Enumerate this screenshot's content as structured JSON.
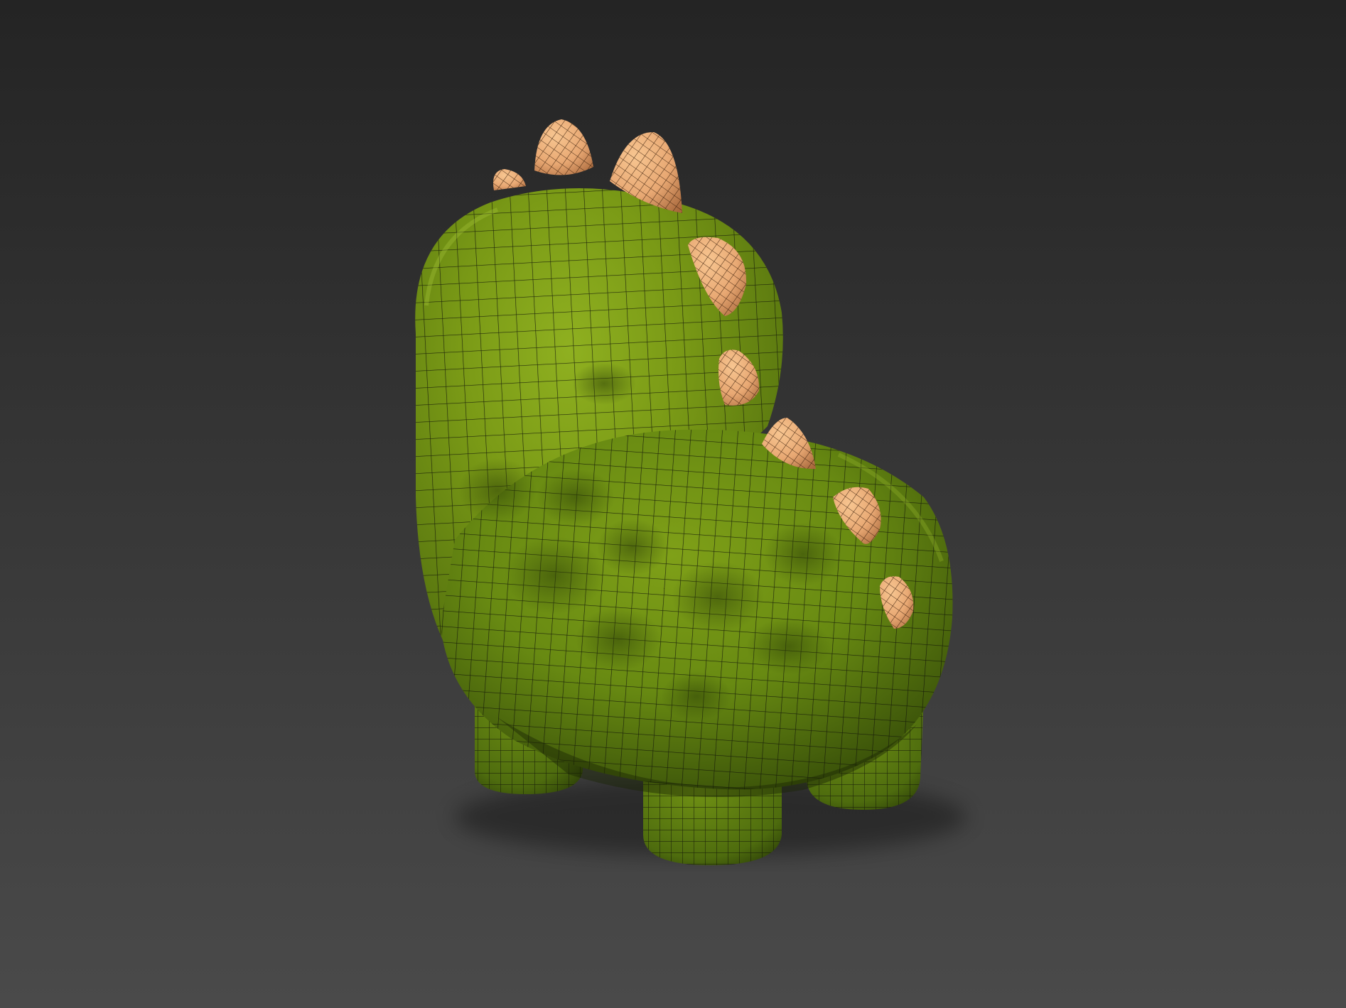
{
  "scene": {
    "subject": "stylized-dinosaur-wireframe-model",
    "colors": {
      "background_top": "#242424",
      "background_bottom": "#4a4a4a",
      "body_light": "#86a41a",
      "body_mid": "#6a8a14",
      "body_dark": "#39500a",
      "spike_light": "#f7c590",
      "spike_mid": "#e8a873",
      "spike_dark": "#b27445",
      "wire": "#101308"
    }
  }
}
